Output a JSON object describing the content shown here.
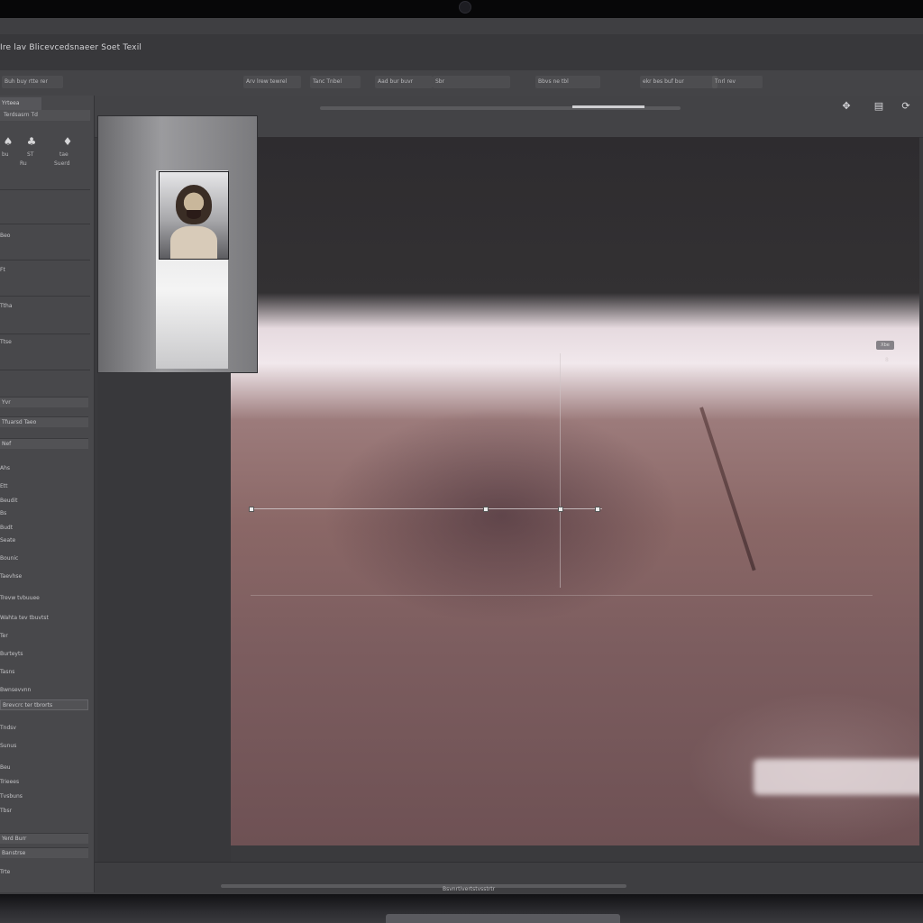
{
  "window": {
    "title": "Ire lav Blicevcedsnaeer Soet Texil"
  },
  "options_bar": {
    "items": [
      "Buh buy rtte rer",
      "Arv lrew tewrel",
      "Tanc Tnbel",
      "Aad bur buvr",
      "Sbr",
      "Bbvs ne tbl",
      "ekr bes buf bur",
      "Tnrl rev"
    ]
  },
  "sidebar": {
    "tab": "Yrteea",
    "header": "Terdsasrn  Td",
    "panel_labels": [
      "bu",
      "ST",
      "tae"
    ],
    "sub_labels": [
      "Ru",
      "Suerd"
    ],
    "items": [
      "Beo",
      "Ft",
      "Ttha",
      "Ttse",
      "Yvr",
      "Tfuarsd Taeo",
      "Nef",
      "Ahs",
      "Ett",
      "Beudit",
      "Bs",
      "Budt",
      "Seate",
      "Bounic",
      "Taevhse",
      "Trevw tvbuuee",
      "Wahta tev tbuvtst",
      "Ter",
      "Burteyts",
      "Tasns",
      "Bwnsevvnn",
      "Tndsv",
      "Sunus",
      "Beu",
      "Trieees",
      "Tvsbuns",
      "Tbsr",
      "Banstrse",
      "Trte"
    ],
    "field_a": "Yerd Burr",
    "field_b": "Brevcrc ter tbrorts"
  },
  "toolbar": {
    "icons": [
      "hand-icon",
      "panel-icon",
      "rotate-icon"
    ]
  },
  "canvas": {
    "badge": "Xbe",
    "marker": "8"
  },
  "status_bar": {
    "text": "Bsvnrtivertstvsstrtr"
  }
}
